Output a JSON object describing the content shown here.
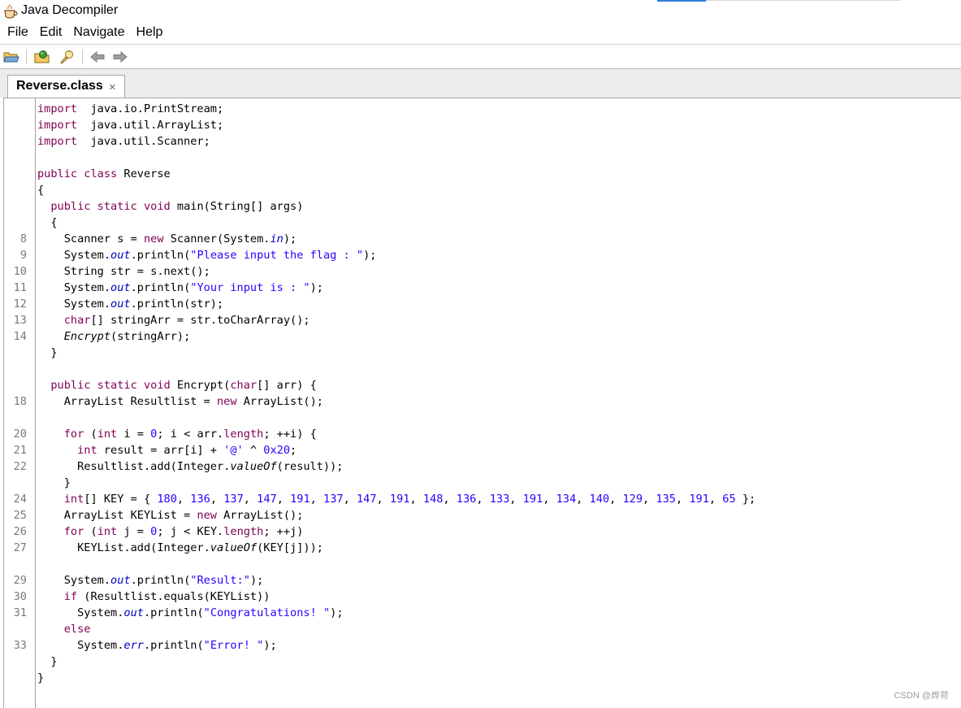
{
  "window": {
    "title": "Java Decompiler"
  },
  "menu": {
    "file": "File",
    "edit": "Edit",
    "navigate": "Navigate",
    "help": "Help"
  },
  "toolbar": {
    "icons": [
      "open-file-icon",
      "open-type-icon",
      "search-icon",
      "back-arrow-icon",
      "forward-arrow-icon"
    ]
  },
  "tab": {
    "label": "Reverse.class",
    "close": "×"
  },
  "colors": {
    "keyword": "#7f0055",
    "string": "#2a00ff",
    "field": "#0000c0",
    "gutter_text": "#7a7a7a"
  },
  "code": {
    "lines": [
      {
        "n": "",
        "t": [
          [
            "kw",
            "import"
          ],
          [
            "",
            "  java.io.PrintStream;"
          ]
        ]
      },
      {
        "n": "",
        "t": [
          [
            "kw",
            "import"
          ],
          [
            "",
            "  java.util.ArrayList;"
          ]
        ]
      },
      {
        "n": "",
        "t": [
          [
            "kw",
            "import"
          ],
          [
            "",
            "  java.util.Scanner;"
          ]
        ]
      },
      {
        "n": "",
        "t": []
      },
      {
        "n": "",
        "t": [
          [
            "kw",
            "public class"
          ],
          [
            "",
            " Reverse"
          ]
        ]
      },
      {
        "n": "",
        "t": [
          [
            "",
            "{"
          ]
        ]
      },
      {
        "n": "",
        "t": [
          [
            "",
            "  "
          ],
          [
            "kw",
            "public static void"
          ],
          [
            "",
            " main(String[] args)"
          ]
        ]
      },
      {
        "n": "",
        "t": [
          [
            "",
            "  {"
          ]
        ]
      },
      {
        "n": "8",
        "t": [
          [
            "",
            "    Scanner s = "
          ],
          [
            "kw",
            "new"
          ],
          [
            "",
            " Scanner(System."
          ],
          [
            "fld",
            "in"
          ],
          [
            "",
            ");"
          ]
        ]
      },
      {
        "n": "9",
        "t": [
          [
            "",
            "    System."
          ],
          [
            "fld",
            "out"
          ],
          [
            "",
            ".println("
          ],
          [
            "str",
            "\"Please input the flag : \""
          ],
          [
            "",
            ");"
          ]
        ]
      },
      {
        "n": "10",
        "t": [
          [
            "",
            "    String str = s.next();"
          ]
        ]
      },
      {
        "n": "11",
        "t": [
          [
            "",
            "    System."
          ],
          [
            "fld",
            "out"
          ],
          [
            "",
            ".println("
          ],
          [
            "str",
            "\"Your input is : \""
          ],
          [
            "",
            ");"
          ]
        ]
      },
      {
        "n": "12",
        "t": [
          [
            "",
            "    System."
          ],
          [
            "fld",
            "out"
          ],
          [
            "",
            ".println(str);"
          ]
        ]
      },
      {
        "n": "13",
        "t": [
          [
            "",
            "    "
          ],
          [
            "kw",
            "char"
          ],
          [
            "",
            "[] stringArr = str.toCharArray();"
          ]
        ]
      },
      {
        "n": "14",
        "t": [
          [
            "",
            "    "
          ],
          [
            "ital",
            "Encrypt"
          ],
          [
            "",
            "(stringArr);"
          ]
        ]
      },
      {
        "n": "",
        "t": [
          [
            "",
            "  }"
          ]
        ]
      },
      {
        "n": "",
        "t": []
      },
      {
        "n": "",
        "t": [
          [
            "",
            "  "
          ],
          [
            "kw",
            "public static void"
          ],
          [
            "",
            " Encrypt("
          ],
          [
            "kw",
            "char"
          ],
          [
            "",
            "[] arr) {"
          ]
        ]
      },
      {
        "n": "18",
        "t": [
          [
            "",
            "    ArrayList Resultlist = "
          ],
          [
            "kw",
            "new"
          ],
          [
            "",
            " ArrayList();"
          ]
        ]
      },
      {
        "n": "",
        "t": []
      },
      {
        "n": "20",
        "t": [
          [
            "",
            "    "
          ],
          [
            "kw",
            "for"
          ],
          [
            "",
            " ("
          ],
          [
            "kw",
            "int"
          ],
          [
            "",
            " i = "
          ],
          [
            "num",
            "0"
          ],
          [
            "",
            "; i < arr."
          ],
          [
            "kw",
            "length"
          ],
          [
            "",
            "; ++i) {"
          ]
        ]
      },
      {
        "n": "21",
        "t": [
          [
            "",
            "      "
          ],
          [
            "kw",
            "int"
          ],
          [
            "",
            " result = arr[i] + "
          ],
          [
            "str",
            "'@'"
          ],
          [
            "",
            " ^ "
          ],
          [
            "num",
            "0x20"
          ],
          [
            "",
            ";"
          ]
        ]
      },
      {
        "n": "22",
        "t": [
          [
            "",
            "      Resultlist.add(Integer."
          ],
          [
            "ital",
            "valueOf"
          ],
          [
            "",
            "(result));"
          ]
        ]
      },
      {
        "n": "",
        "t": [
          [
            "",
            "    }"
          ]
        ]
      },
      {
        "n": "24",
        "t": [
          [
            "",
            "    "
          ],
          [
            "kw",
            "int"
          ],
          [
            "",
            "[] KEY = { "
          ],
          [
            "num",
            "180"
          ],
          [
            "",
            ", "
          ],
          [
            "num",
            "136"
          ],
          [
            "",
            ", "
          ],
          [
            "num",
            "137"
          ],
          [
            "",
            ", "
          ],
          [
            "num",
            "147"
          ],
          [
            "",
            ", "
          ],
          [
            "num",
            "191"
          ],
          [
            "",
            ", "
          ],
          [
            "num",
            "137"
          ],
          [
            "",
            ", "
          ],
          [
            "num",
            "147"
          ],
          [
            "",
            ", "
          ],
          [
            "num",
            "191"
          ],
          [
            "",
            ", "
          ],
          [
            "num",
            "148"
          ],
          [
            "",
            ", "
          ],
          [
            "num",
            "136"
          ],
          [
            "",
            ", "
          ],
          [
            "num",
            "133"
          ],
          [
            "",
            ", "
          ],
          [
            "num",
            "191"
          ],
          [
            "",
            ", "
          ],
          [
            "num",
            "134"
          ],
          [
            "",
            ", "
          ],
          [
            "num",
            "140"
          ],
          [
            "",
            ", "
          ],
          [
            "num",
            "129"
          ],
          [
            "",
            ", "
          ],
          [
            "num",
            "135"
          ],
          [
            "",
            ", "
          ],
          [
            "num",
            "191"
          ],
          [
            "",
            ", "
          ],
          [
            "num",
            "65"
          ],
          [
            "",
            " };"
          ]
        ]
      },
      {
        "n": "25",
        "t": [
          [
            "",
            "    ArrayList KEYList = "
          ],
          [
            "kw",
            "new"
          ],
          [
            "",
            " ArrayList();"
          ]
        ]
      },
      {
        "n": "26",
        "t": [
          [
            "",
            "    "
          ],
          [
            "kw",
            "for"
          ],
          [
            "",
            " ("
          ],
          [
            "kw",
            "int"
          ],
          [
            "",
            " j = "
          ],
          [
            "num",
            "0"
          ],
          [
            "",
            "; j < KEY."
          ],
          [
            "kw",
            "length"
          ],
          [
            "",
            "; ++j)"
          ]
        ]
      },
      {
        "n": "27",
        "t": [
          [
            "",
            "      KEYList.add(Integer."
          ],
          [
            "ital",
            "valueOf"
          ],
          [
            "",
            "(KEY[j]));"
          ]
        ]
      },
      {
        "n": "",
        "t": []
      },
      {
        "n": "29",
        "t": [
          [
            "",
            "    System."
          ],
          [
            "fld",
            "out"
          ],
          [
            "",
            ".println("
          ],
          [
            "str",
            "\"Result:\""
          ],
          [
            "",
            ");"
          ]
        ]
      },
      {
        "n": "30",
        "t": [
          [
            "",
            "    "
          ],
          [
            "kw",
            "if"
          ],
          [
            "",
            " (Resultlist.equals(KEYList))"
          ]
        ]
      },
      {
        "n": "31",
        "t": [
          [
            "",
            "      System."
          ],
          [
            "fld",
            "out"
          ],
          [
            "",
            ".println("
          ],
          [
            "str",
            "\"Congratulations! \""
          ],
          [
            "",
            ");"
          ]
        ]
      },
      {
        "n": "",
        "t": [
          [
            "",
            "    "
          ],
          [
            "kw",
            "else"
          ]
        ]
      },
      {
        "n": "33",
        "t": [
          [
            "",
            "      System."
          ],
          [
            "fld",
            "err"
          ],
          [
            "",
            ".println("
          ],
          [
            "str",
            "\"Error! \""
          ],
          [
            "",
            ");"
          ]
        ]
      },
      {
        "n": "",
        "t": [
          [
            "",
            "  }"
          ]
        ]
      },
      {
        "n": "",
        "t": [
          [
            "",
            "}"
          ]
        ]
      }
    ]
  },
  "watermark": "CSDN @烨苛"
}
